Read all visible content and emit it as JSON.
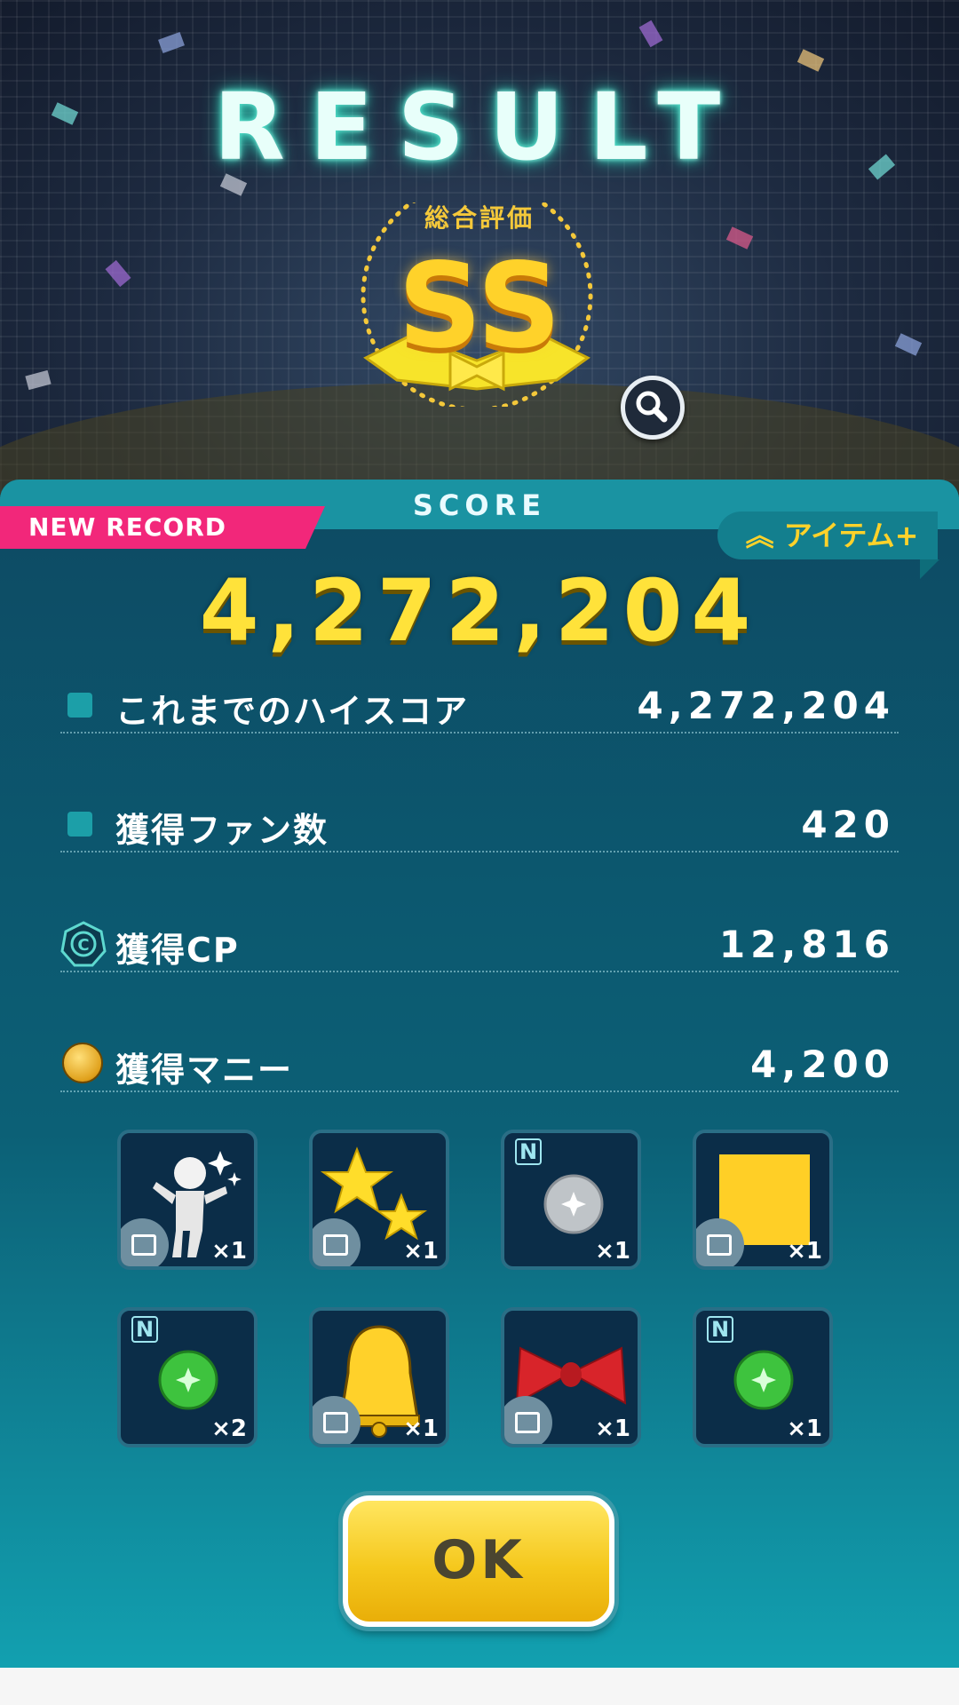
{
  "header": {
    "title": "RESULT",
    "evaluation_label": "総合評価",
    "grade": "SS"
  },
  "score_panel": {
    "section_label": "SCORE",
    "new_record_label": "NEW RECORD",
    "item_plus_label": "アイテム+",
    "total_score": "4,272,204",
    "rows": [
      {
        "label": "これまでのハイスコア",
        "value": "4,272,204"
      },
      {
        "label": "獲得ファン数",
        "value": "420"
      },
      {
        "label": "獲得CP",
        "value": "12,816"
      },
      {
        "label": "獲得マニー",
        "value": "4,200"
      }
    ]
  },
  "rewards": [
    {
      "icon": "pose-figure-icon",
      "qty": "×1"
    },
    {
      "icon": "sparkle-stars-icon",
      "qty": "×1"
    },
    {
      "icon": "silver-orb-icon",
      "qty": "×1",
      "badge": "N"
    },
    {
      "icon": "yellow-square-icon",
      "qty": "×1"
    },
    {
      "icon": "green-orb-icon",
      "qty": "×2",
      "badge": "N"
    },
    {
      "icon": "bell-icon",
      "qty": "×1"
    },
    {
      "icon": "red-bow-icon",
      "qty": "×1"
    },
    {
      "icon": "green-orb-icon",
      "qty": "×1",
      "badge": "N"
    }
  ],
  "ok_button": {
    "label": "OK"
  },
  "colors": {
    "accent_gold": "#ffd22a",
    "new_record_pink": "#f2277a",
    "panel_teal": "#0c6076"
  }
}
